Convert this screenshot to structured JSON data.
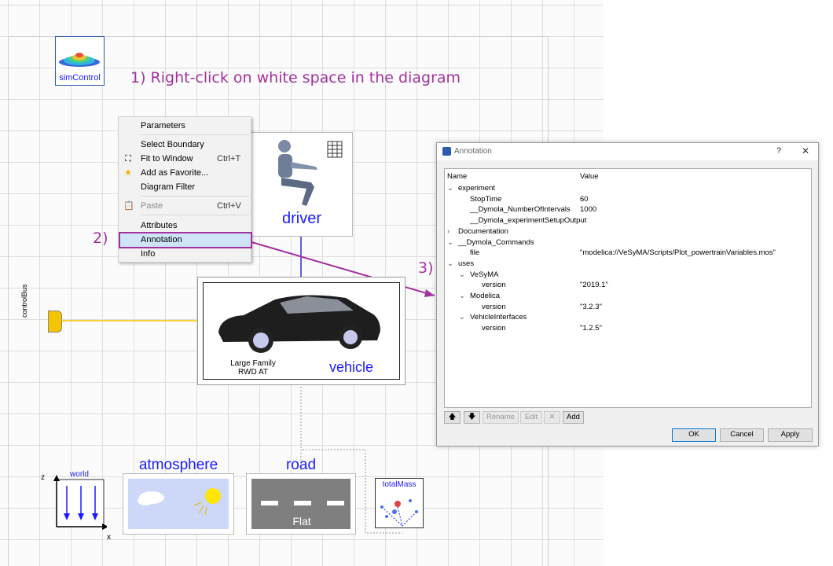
{
  "instructions": {
    "step1": "1) Right-click on white space in the diagram",
    "step2": "2)",
    "step3": "3)"
  },
  "components": {
    "simcontrol": "simControl",
    "driver": "driver",
    "vehicle": "vehicle",
    "vehicle_desc1": "Large Family",
    "vehicle_desc2": "RWD AT",
    "controlbus": "controlBus",
    "world": "world",
    "world_z": "z",
    "world_x": "x",
    "atmosphere": "atmosphere",
    "road": "road",
    "road_type": "Flat",
    "totalmass": "totalMass"
  },
  "context_menu": {
    "parameters": "Parameters",
    "select_boundary": "Select Boundary",
    "fit_to_window": "Fit to Window",
    "fit_to_window_shortcut": "Ctrl+T",
    "add_favorite": "Add as Favorite...",
    "diagram_filter": "Diagram Filter",
    "paste": "Paste",
    "paste_shortcut": "Ctrl+V",
    "attributes": "Attributes",
    "annotation": "Annotation",
    "info": "Info"
  },
  "dialog": {
    "title": "Annotation",
    "help": "?",
    "close": "✕",
    "col_name": "Name",
    "col_value": "Value",
    "rows": [
      {
        "name": "experiment",
        "value": "",
        "expander": "⌄"
      },
      {
        "name": "StopTime",
        "value": "60",
        "expander": ""
      },
      {
        "name": "__Dymola_NumberOfIntervals",
        "value": "1000",
        "expander": ""
      },
      {
        "name": "__Dymola_experimentSetupOutput",
        "value": "",
        "expander": ""
      },
      {
        "name": "Documentation",
        "value": "",
        "expander": "›"
      },
      {
        "name": "__Dymola_Commands",
        "value": "",
        "expander": "⌄"
      },
      {
        "name": "file",
        "value": "\"modelica://VeSyMA/Scripts/Plot_powertrainVariables.mos\"",
        "expander": ""
      },
      {
        "name": "uses",
        "value": "",
        "expander": "⌄"
      },
      {
        "name": "VeSyMA",
        "value": "",
        "expander": "⌄"
      },
      {
        "name": "version",
        "value": "\"2019.1\"",
        "expander": ""
      },
      {
        "name": "Modelica",
        "value": "",
        "expander": "⌄"
      },
      {
        "name": "version",
        "value": "\"3.2.3\"",
        "expander": ""
      },
      {
        "name": "VehicleInterfaces",
        "value": "",
        "expander": "⌄"
      },
      {
        "name": "version",
        "value": "\"1.2.5\"",
        "expander": ""
      }
    ],
    "btn_up": "🡅",
    "btn_down": "🡇",
    "btn_rename": "Rename",
    "btn_edit": "Edit",
    "btn_delete": "✕",
    "btn_add": "Add",
    "btn_ok": "OK",
    "btn_cancel": "Cancel",
    "btn_apply": "Apply"
  },
  "colors": {
    "instruction": "#a3319e",
    "label_blue": "#1a1aff",
    "highlight": "#cfe4f7"
  }
}
